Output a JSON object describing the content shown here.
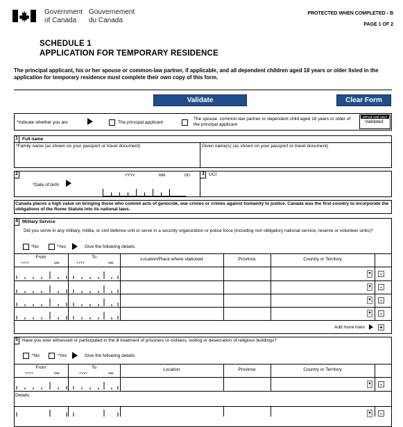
{
  "header": {
    "gov_en_line1": "Government",
    "gov_en_line2": "of Canada",
    "gov_fr_line1": "Gouvernement",
    "gov_fr_line2": "du Canada",
    "protected": "PROTECTED WHEN COMPLETED - B",
    "page": "PAGE 1 OF 2",
    "flag_icon": "canada-flag-icon"
  },
  "title": {
    "line1": "SCHEDULE 1",
    "line2": "APPLICATION FOR TEMPORARY RESIDENCE"
  },
  "intro": "The principal applicant, his or her spouse or common-law partner, if applicable, and all dependent children aged 18 years or older listed in the application for temporary residence must complete their own copy of this form.",
  "buttons": {
    "validate": "Validate",
    "clear": "Clear Form"
  },
  "indicate": {
    "label": "*Indicate whether you are",
    "opt1": "The principal applicant",
    "opt2": "The spouse, common-law partner or dependent child aged 18 years or older of the principal applicant",
    "office_use": "OFFICE USE ONLY",
    "validated": "Validated"
  },
  "s1": {
    "num": "1",
    "title": "Full name",
    "family": "*Family name  (as shown on your passport or travel document)",
    "given": "Given name(s)  (as shown on your passport or travel document)"
  },
  "s2": {
    "num": "2",
    "yyyy": "YYYY",
    "mm": "MM",
    "dd": "DD",
    "dob": "*Date of birth"
  },
  "s3": {
    "num": "3",
    "uci": "UCI"
  },
  "canada_note": "Canada places a high value on bringing those who commit acts of genocide, war crimes or crimes against humanity to justice. Canada was the first country to incorporate the obligations of the Rome Statute into its national laws.",
  "s4": {
    "num": "4",
    "title": "Military Service",
    "question": "Did you serve in any military, militia, or civil defence unit or serve in a security organization or police force (including non obligatory national service, reserve or volunteer units)?",
    "no": "*No",
    "yes": "*Yes",
    "give": "Give the following details:",
    "col_from": "From",
    "col_to": "To",
    "yyyy": "YYYY",
    "mm": "MM",
    "col_location": "Location/Place where stationed",
    "col_province": "Province",
    "col_country": "Country or Territory",
    "add_more": "Add more rows",
    "dropdown_glyph": "▾",
    "minus": "-",
    "plus": "+"
  },
  "s5": {
    "num": "5",
    "question": "Have you ever witnessed or participated in the ill treatment of prisoners or civilians, looting or desecration of religious buildings?",
    "no": "*No",
    "yes": "*Yes",
    "give": "Give the following details:",
    "col_from": "From",
    "col_to": "To",
    "yyyy": "YYYY",
    "mm": "MM",
    "col_location": "Location",
    "col_province": "Province",
    "col_country": "Country or Territory",
    "details": "Details:",
    "dropdown_glyph": "▾",
    "minus": "-"
  }
}
